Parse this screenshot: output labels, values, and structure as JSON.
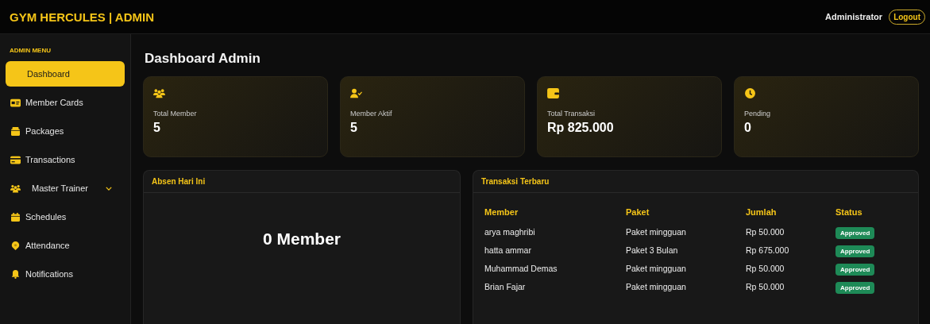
{
  "header": {
    "brand": "GYM HERCULES | ADMIN",
    "user": "Administrator",
    "logout": "Logout"
  },
  "sidebar": {
    "heading": "ADMIN MENU",
    "items": [
      {
        "label": "Dashboard",
        "selected": true
      },
      {
        "label": "Member Cards",
        "selected": false
      },
      {
        "label": "Packages",
        "selected": false
      },
      {
        "label": "Transactions",
        "selected": false
      },
      {
        "label": "Master Trainer",
        "selected": false,
        "expanded": false
      },
      {
        "label": "Schedules",
        "selected": false
      },
      {
        "label": "Attendance",
        "selected": false
      },
      {
        "label": "Notifications",
        "selected": false
      }
    ]
  },
  "page_title": "Dashboard Admin",
  "stats": [
    {
      "label": "Total Member",
      "value": "5"
    },
    {
      "label": "Member Aktif",
      "value": "5"
    },
    {
      "label": "Total Transaksi",
      "value": "Rp 825.000"
    },
    {
      "label": "Pending",
      "value": "0"
    }
  ],
  "attendance": {
    "title": "Absen Hari Ini",
    "count": "0 Member"
  },
  "transactions": {
    "title": "Transaksi Terbaru",
    "columns": [
      "Member",
      "Paket",
      "Jumlah",
      "Status"
    ],
    "rows": [
      {
        "member": "arya maghribi",
        "package": "Paket mingguan",
        "amount": "Rp 50.000",
        "status": "Approved"
      },
      {
        "member": "hatta ammar",
        "package": "Paket 3 Bulan",
        "amount": "Rp 675.000",
        "status": "Approved"
      },
      {
        "member": "Muhammad Demas",
        "package": "Paket mingguan",
        "amount": "Rp 50.000",
        "status": "Approved"
      },
      {
        "member": "Brian Fajar",
        "package": "Paket mingguan",
        "amount": "Rp 50.000",
        "status": "Approved"
      }
    ]
  }
}
